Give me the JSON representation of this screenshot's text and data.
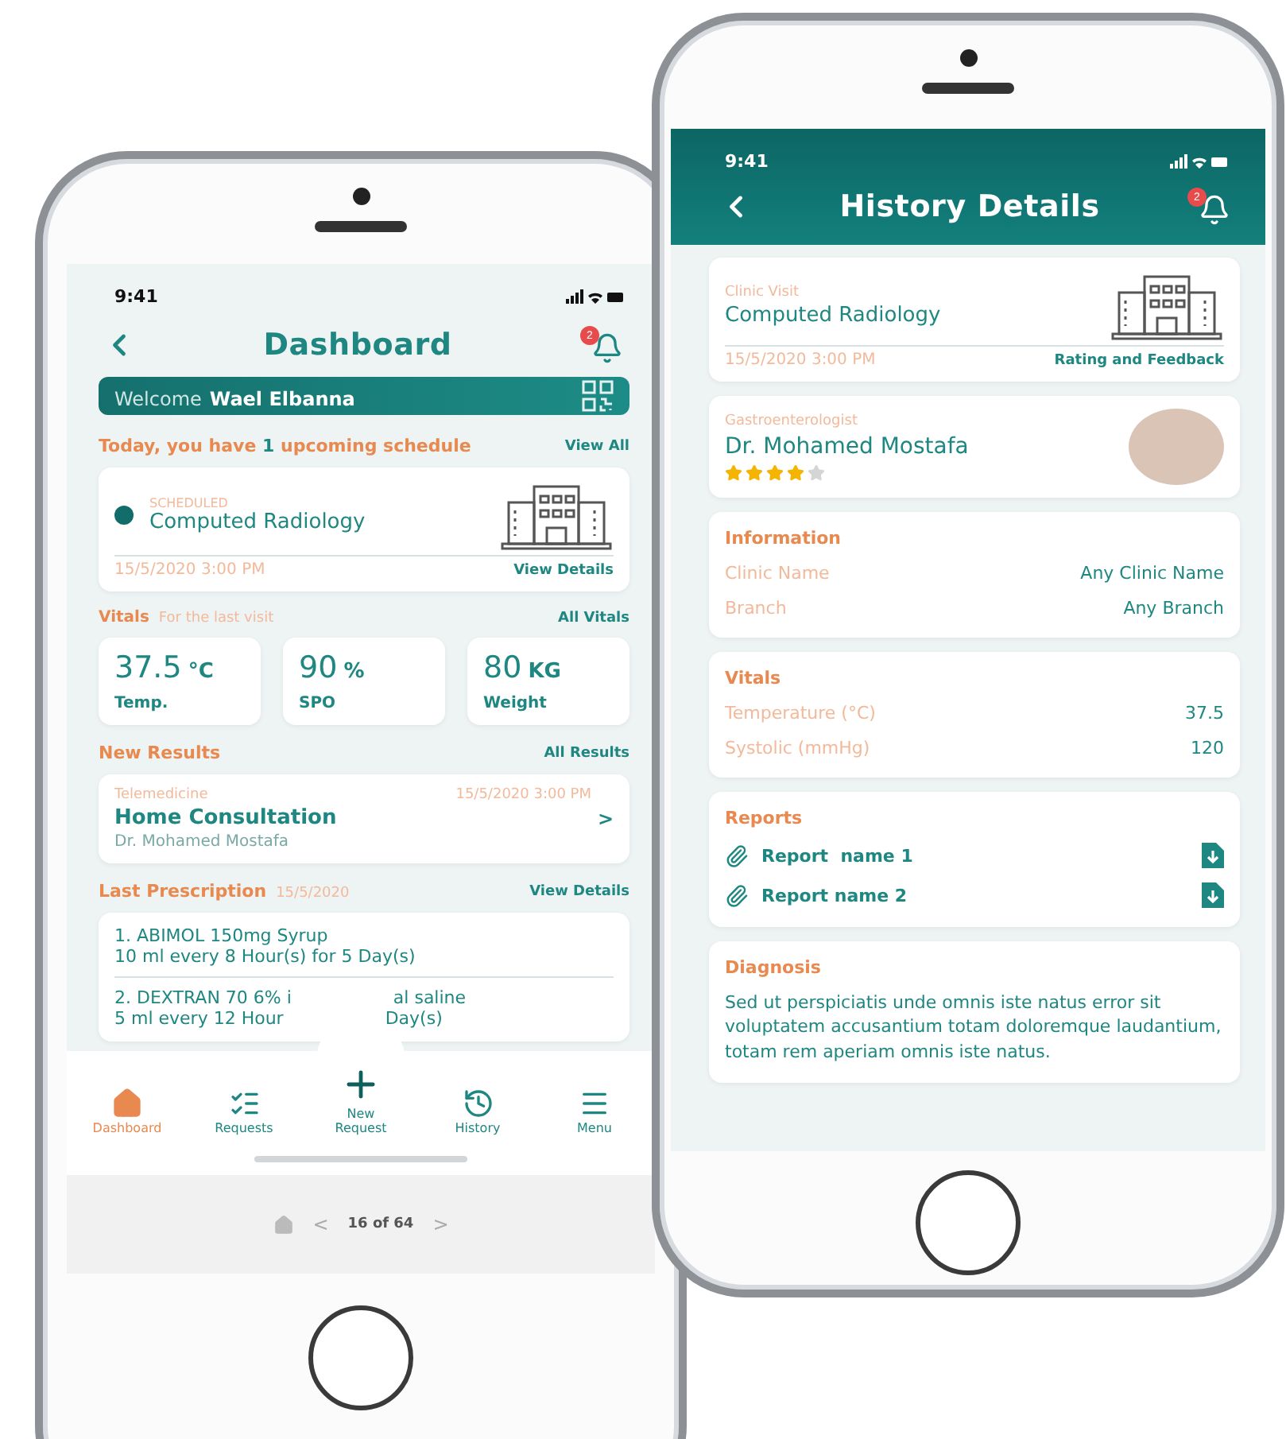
{
  "dashboard": {
    "status_time": "9:41",
    "title": "Dashboard",
    "notification_count": "2",
    "welcome_label": "Welcome",
    "user_name": "Wael Elbanna",
    "today": {
      "before": "Today, you have ",
      "count": "1",
      "after": " upcoming schedule",
      "link": "View All"
    },
    "schedule": {
      "status": "SCHEDULED",
      "name": "Computed Radiology",
      "date": "15/5/2020 3:00 PM",
      "link": "View Details"
    },
    "vitals": {
      "title": "Vitals",
      "subtitle": "For the last visit",
      "link": "All Vitals",
      "items": [
        {
          "value": "37.5",
          "unit": "°C",
          "label": "Temp."
        },
        {
          "value": "90",
          "unit": "%",
          "label": "SPO"
        },
        {
          "value": "80",
          "unit": "KG",
          "label": "Weight"
        }
      ]
    },
    "results": {
      "title": "New Results",
      "link": "All Results",
      "item": {
        "type": "Telemedicine",
        "date": "15/5/2020 3:00 PM",
        "name": "Home Consultation",
        "doctor": "Dr. Mohamed Mostafa",
        "chevron": ">"
      }
    },
    "prescription": {
      "title": "Last Prescription",
      "date": "15/5/2020",
      "link": "View Details",
      "items": [
        {
          "lines": [
            [
              "1. ABIMOL 150mg Syrup"
            ],
            [
              "10 ml every 8 Hour(s) for 5 Day(s)"
            ]
          ]
        },
        {
          "lines": [
            [
              "2. DEXTRAN 70 6% i",
              "al saline"
            ],
            [
              "5 ml every 12 Hour",
              "Day(s)"
            ]
          ]
        }
      ]
    },
    "nav": [
      {
        "label": "Dashboard",
        "selected": true
      },
      {
        "label": "Requests",
        "selected": false
      },
      {
        "label": "New\nRequest",
        "selected": false
      },
      {
        "label": "History",
        "selected": false
      },
      {
        "label": "Menu",
        "selected": false
      }
    ],
    "pager": {
      "text": "16 of 64",
      "prev": "<",
      "next": ">"
    }
  },
  "history": {
    "status_time": "9:41",
    "title": "History Details",
    "notification_count": "2",
    "visit": {
      "type": "Clinic Visit",
      "name": "Computed Radiology",
      "date": "15/5/2020 3:00 PM",
      "link": "Rating and Feedback"
    },
    "doctor": {
      "specialty": "Gastroenterologist",
      "name": "Dr. Mohamed Mostafa",
      "stars": 4
    },
    "information": {
      "title": "Information",
      "rows": [
        {
          "label": "Clinic Name",
          "value": "Any Clinic Name"
        },
        {
          "label": "Branch",
          "value": "Any Branch"
        }
      ]
    },
    "vitals": {
      "title": "Vitals",
      "rows": [
        {
          "label": "Temperature (°C)",
          "value": "37.5"
        },
        {
          "label": "Systolic (mmHg)",
          "value": "120"
        }
      ]
    },
    "reports": {
      "title": "Reports",
      "items": [
        "Report  name 1",
        "Report name 2"
      ]
    },
    "diagnosis": {
      "title": "Diagnosis",
      "text": "Sed ut perspiciatis unde omnis iste natus error sit voluptatem accusantium totam  doloremque laudantium, totam rem aperiam omnis iste natus."
    }
  }
}
